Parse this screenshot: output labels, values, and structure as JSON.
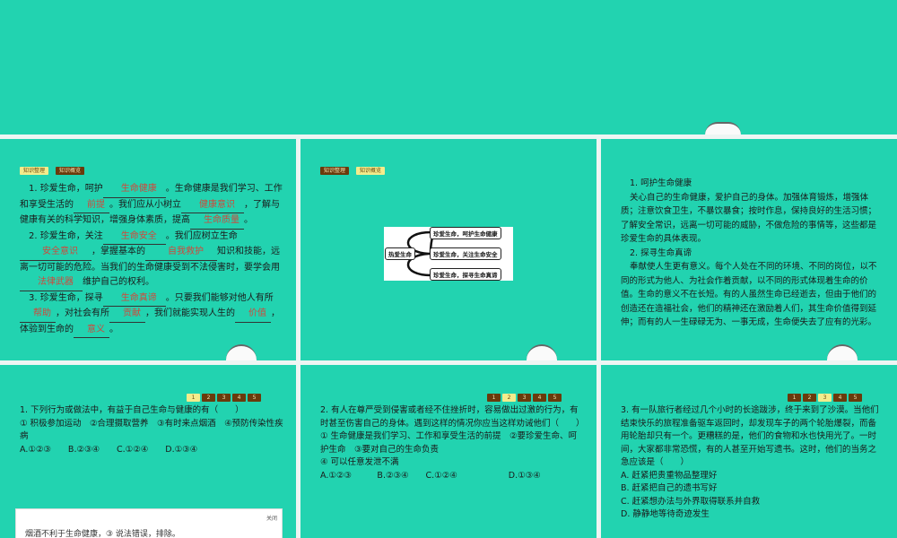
{
  "tags": {
    "organize": "知识整理",
    "overview": "知识概览"
  },
  "slide1": {
    "p1": [
      "1. 珍爱生命，呵护",
      "生命健康",
      "。生命健康是我们学习、工作和享受生活的",
      "前提",
      "。我们应从小树立",
      "健康意识",
      "，了解与健康有关的科学知识，增强身体素质，提高",
      "生命质量",
      "。"
    ],
    "p2": [
      "2. 珍爱生命，关注",
      "生命安全",
      "。我们应树立生命",
      "安全意识",
      "，掌握基本的",
      "自我救护",
      "知识和技能，远离一切可能的危险。当我们的生命健康受到不法侵害时，要学会用",
      "法律武器",
      "维护自己的权利。"
    ],
    "p3": [
      "3. 珍爱生命，探寻",
      "生命真谛",
      "。只要我们能够对他人有所",
      "帮助",
      "，对社会有所",
      "贡献",
      "，我们就能实现人生的",
      "价值",
      "，体验到生命的",
      "意义",
      "。"
    ]
  },
  "slide2": {
    "root": "热爱生命",
    "branches": [
      "珍爱生命，呵护生命健康",
      "珍爱生命，关注生命安全",
      "珍爱生命，探寻生命真谛"
    ]
  },
  "slide3": {
    "h1": "1. 呵护生命健康",
    "p1": "关心自己的生命健康，爱护自己的身体。加强体育锻炼，增强体质；注意饮食卫生，不暴饮暴食；按时作息，保持良好的生活习惯；了解安全常识，远离一切可能的威胁，不做危险的事情等，这些都是珍爱生命的具体表现。",
    "h2": "2. 探寻生命真谛",
    "p2": "奉献使人生更有意义。每个人处在不同的环境、不同的岗位，以不同的形式为他人、为社会作着贡献，以不同的形式体现着生命的价值。生命的意义不在长短。有的人虽然生命已经逝去，但由于他们的创造还在造福社会，他们的精神还在激励着人们，其生命价值得到延伸；而有的人一生碌碌无为、一事无成，生命便失去了应有的光彩。"
  },
  "pages": [
    "1",
    "2",
    "3",
    "4",
    "5"
  ],
  "q1": {
    "stem": "1. 下列行为或做法中，有益于自己生命与健康的有（　　）",
    "items": "① 积极参加运动　②合理摄取营养　③有时来点烟酒　④预防传染性疾病",
    "options": [
      "A.①②③",
      "B.②③④",
      "C.①②④",
      "D.①③④"
    ],
    "popup_close": "关闭",
    "popup_text": "烟酒不利于生命健康，③ 说法错误，排除。"
  },
  "q2": {
    "stem": "2. 有人在尊严受到侵害或者经不住挫折时，容易做出过激的行为，有时甚至伤害自己的身体。遇到这样的情况你应当这样劝诫他们（　　）",
    "items": [
      "① 生命健康是我们学习、工作和享受生活的前提　②要珍爱生命、呵护生命　③要对自己的生命负责",
      "④ 可以任意发泄不满"
    ],
    "options": [
      "A.①②③",
      "B.②③④",
      "C.①②④",
      "D.①③④"
    ]
  },
  "q3": {
    "stem": "3. 有一队旅行者经过几个小时的长途跋涉，终于来到了沙漠。当他们结束快乐的旅程准备驱车返回时，却发现车子的两个轮胎爆裂，而备用轮胎却只有一个。更糟糕的是，他们的食物和水也快用光了。一时间，大家都非常恐慌，有的人甚至开始写遗书。这时，他们的当务之急应该是（　　）",
    "options": [
      "A. 赶紧把贵重物品整理好",
      "B. 赶紧把自己的遗书写好",
      "C. 赶紧想办法与外界取得联系并自救",
      "D. 静静地等待奇迹发生"
    ]
  }
}
